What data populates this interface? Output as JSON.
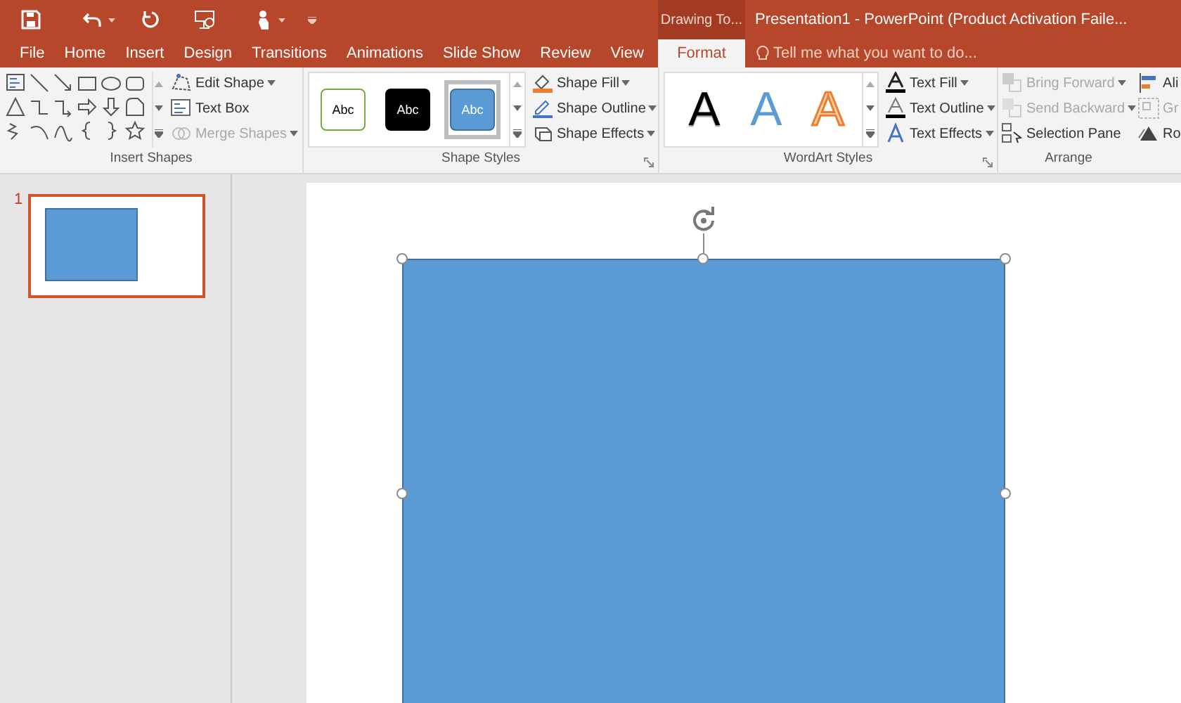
{
  "title_bar": {
    "contextual_tab": "Drawing To...",
    "title": "Presentation1 - PowerPoint (Product Activation Faile..."
  },
  "tabs": [
    {
      "label": "File",
      "selected": false
    },
    {
      "label": "Home",
      "selected": false
    },
    {
      "label": "Insert",
      "selected": false
    },
    {
      "label": "Design",
      "selected": false
    },
    {
      "label": "Transitions",
      "selected": false
    },
    {
      "label": "Animations",
      "selected": false
    },
    {
      "label": "Slide Show",
      "selected": false
    },
    {
      "label": "Review",
      "selected": false
    },
    {
      "label": "View",
      "selected": false
    },
    {
      "label": "Format",
      "selected": true
    }
  ],
  "tell_me": {
    "placeholder": "Tell me what you want to do..."
  },
  "ribbon": {
    "insert_shapes": {
      "label": "Insert Shapes",
      "commands": [
        {
          "label": "Edit Shape",
          "dropdown": true,
          "disabled": false
        },
        {
          "label": "Text Box",
          "dropdown": false,
          "disabled": false
        },
        {
          "label": "Merge Shapes",
          "dropdown": true,
          "disabled": true
        }
      ]
    },
    "shape_styles": {
      "label": "Shape Styles",
      "styles": [
        {
          "label": "Abc",
          "kind": "outline",
          "selected": false
        },
        {
          "label": "Abc",
          "kind": "dark",
          "selected": false
        },
        {
          "label": "Abc",
          "kind": "blue",
          "selected": true
        }
      ],
      "commands": [
        {
          "label": "Shape Fill",
          "dropdown": true,
          "disabled": false
        },
        {
          "label": "Shape Outline",
          "dropdown": true,
          "disabled": false
        },
        {
          "label": "Shape Effects",
          "dropdown": true,
          "disabled": false
        }
      ]
    },
    "wordart_styles": {
      "label": "WordArt Styles",
      "styles": [
        {
          "label": "A",
          "kind": "black"
        },
        {
          "label": "A",
          "kind": "blue"
        },
        {
          "label": "A",
          "kind": "orange"
        }
      ],
      "commands": [
        {
          "label": "Text Fill",
          "dropdown": true,
          "disabled": false
        },
        {
          "label": "Text Outline",
          "dropdown": true,
          "disabled": false
        },
        {
          "label": "Text Effects",
          "dropdown": true,
          "disabled": false
        }
      ]
    },
    "arrange": {
      "label": "Arrange",
      "commands": [
        {
          "label": "Bring Forward",
          "dropdown": true,
          "disabled": true
        },
        {
          "label": "Send Backward",
          "dropdown": true,
          "disabled": true
        },
        {
          "label": "Selection Pane",
          "dropdown": false,
          "disabled": false
        }
      ],
      "cut_commands": [
        {
          "label": "Ali",
          "disabled": false
        },
        {
          "label": "Gr",
          "disabled": true
        },
        {
          "label": "Ro",
          "disabled": false
        }
      ]
    }
  },
  "slides": [
    {
      "number": "1",
      "selected": true
    }
  ],
  "canvas": {
    "shape": {
      "kind": "rectangle",
      "selected": true
    }
  }
}
